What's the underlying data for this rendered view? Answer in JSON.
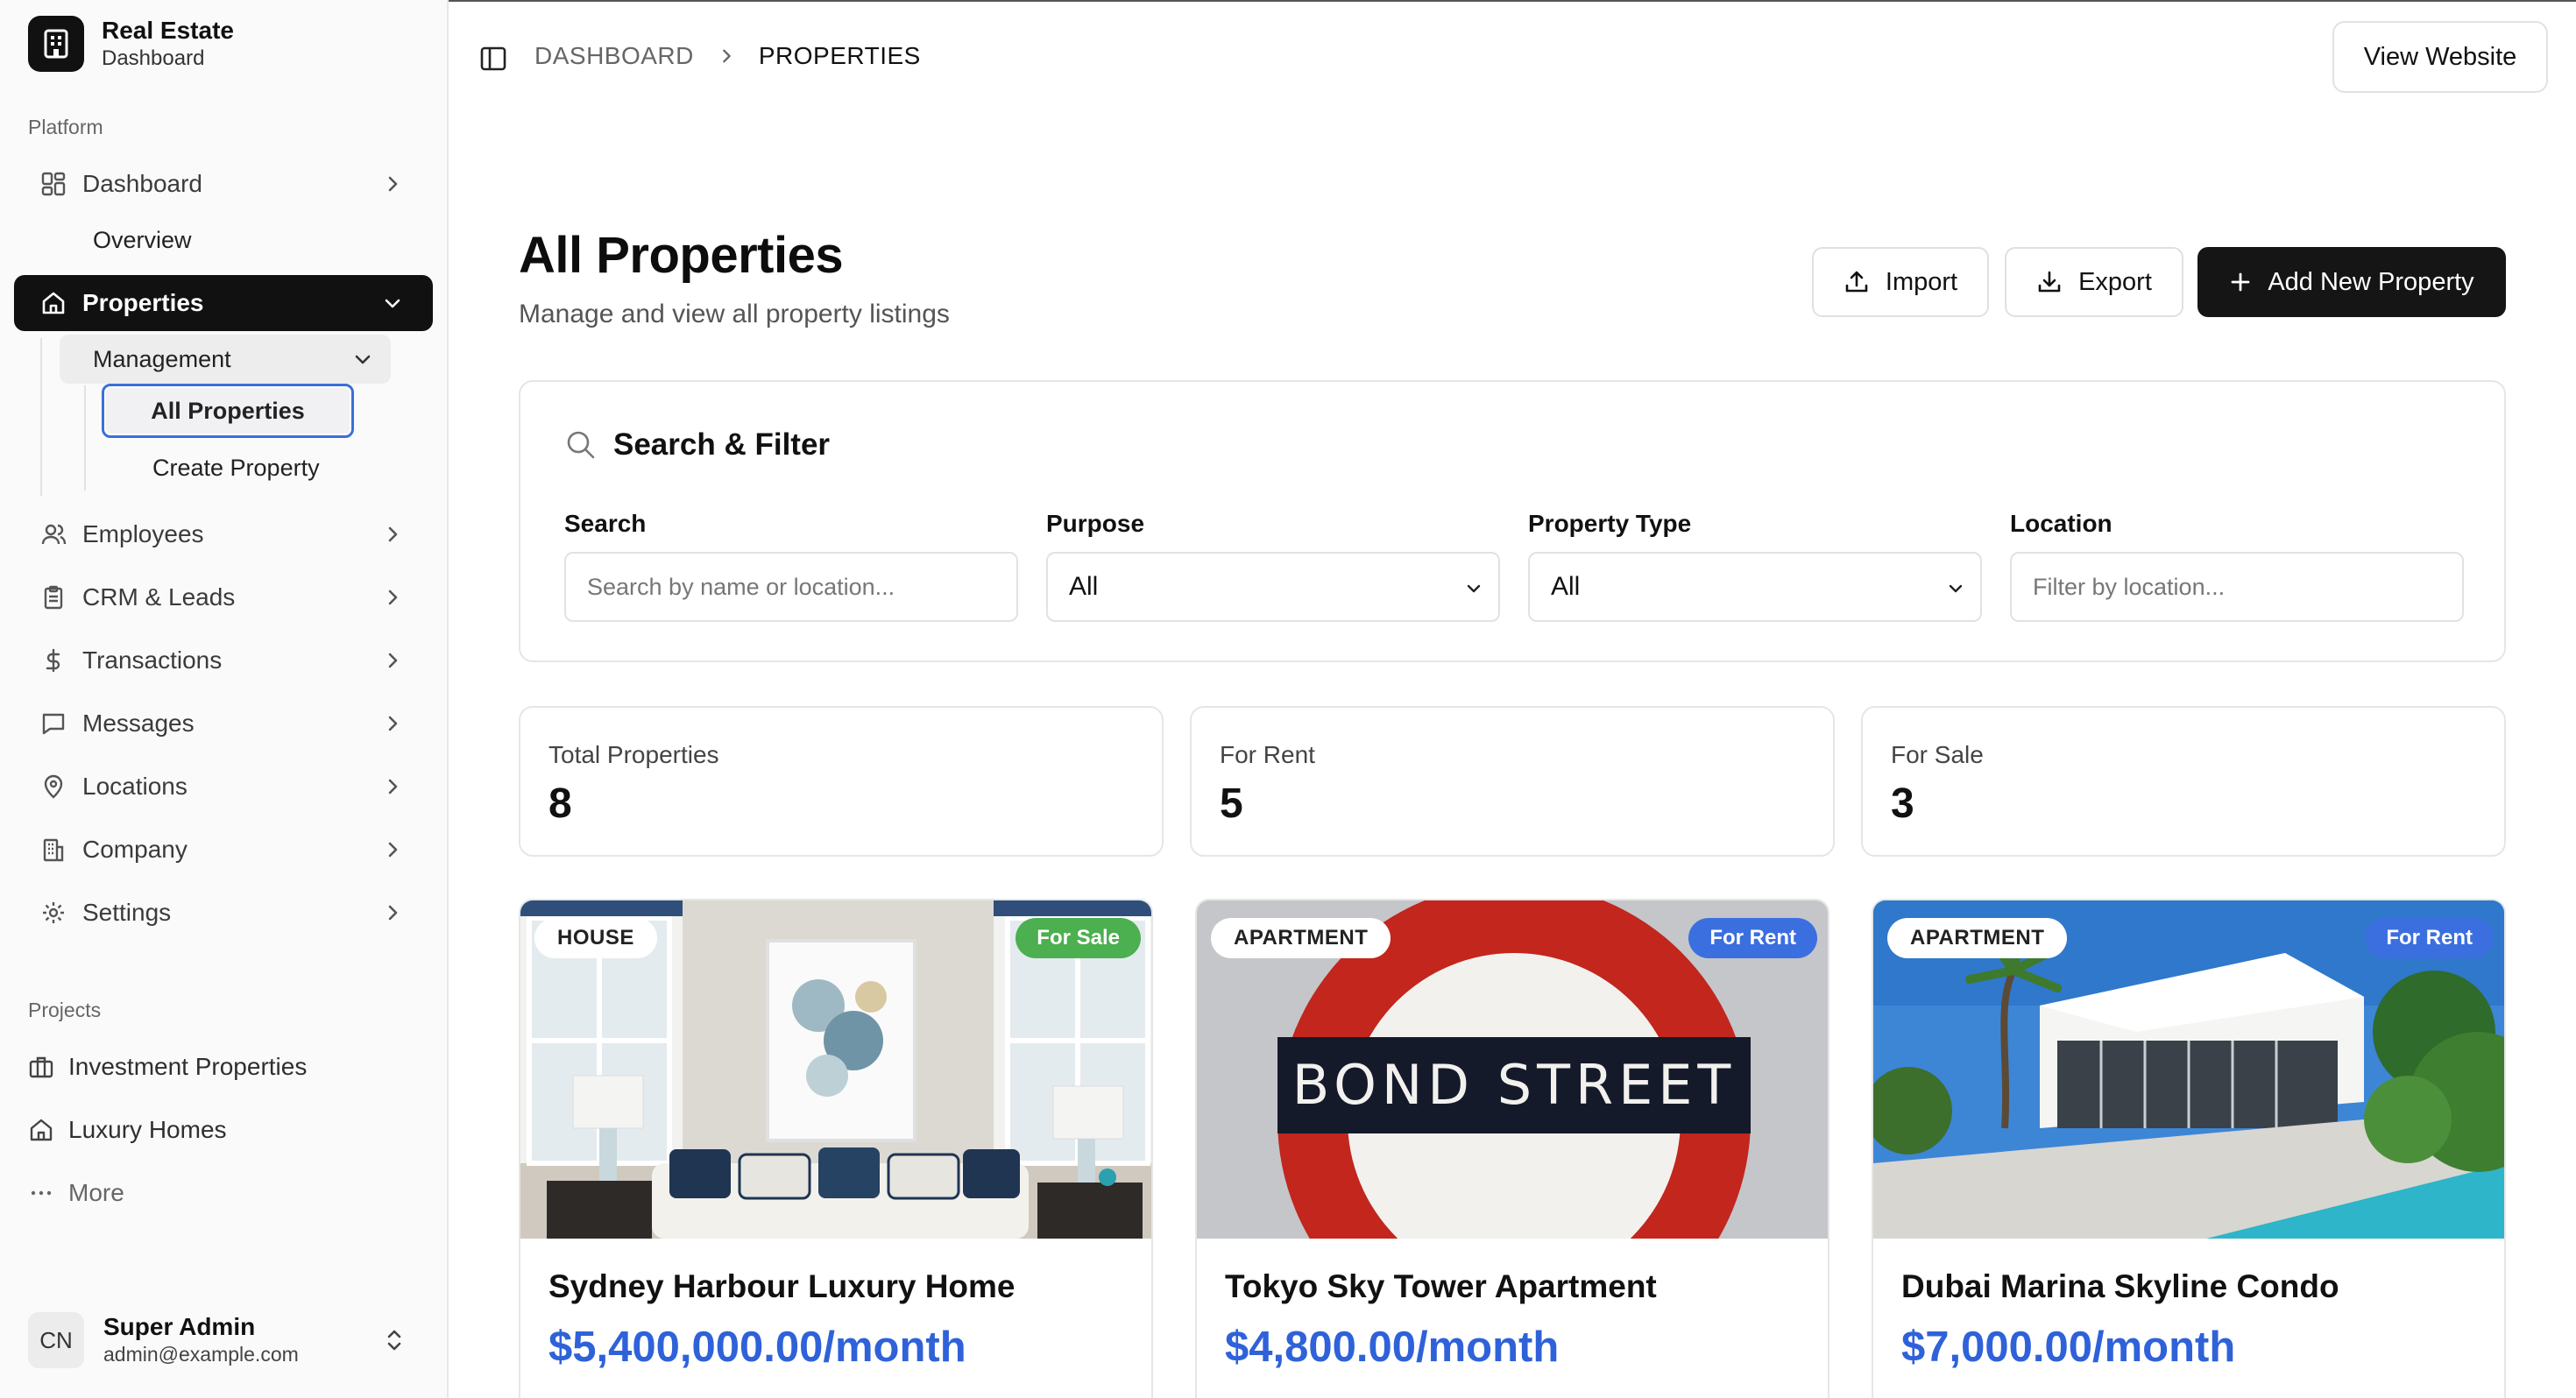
{
  "brand": {
    "title": "Real Estate",
    "subtitle": "Dashboard"
  },
  "sidebar": {
    "platform_label": "Platform",
    "dashboard": {
      "label": "Dashboard",
      "sub": "Overview"
    },
    "properties": {
      "label": "Properties",
      "management": "Management",
      "all_properties": "All Properties",
      "create_property": "Create Property"
    },
    "items": [
      {
        "label": "Employees",
        "icon": "users-icon"
      },
      {
        "label": "CRM & Leads",
        "icon": "clipboard-icon"
      },
      {
        "label": "Transactions",
        "icon": "dollar-icon"
      },
      {
        "label": "Messages",
        "icon": "message-icon"
      },
      {
        "label": "Locations",
        "icon": "map-pin-icon"
      },
      {
        "label": "Company",
        "icon": "building-icon"
      },
      {
        "label": "Settings",
        "icon": "gear-icon"
      }
    ],
    "projects_label": "Projects",
    "projects": [
      {
        "label": "Investment Properties",
        "icon": "briefcase-icon"
      },
      {
        "label": "Luxury Homes",
        "icon": "home-icon"
      },
      {
        "label": "More",
        "icon": "more-icon"
      }
    ]
  },
  "user": {
    "initials": "CN",
    "name": "Super Admin",
    "email": "admin@example.com"
  },
  "breadcrumb": {
    "parent": "DASHBOARD",
    "current": "PROPERTIES"
  },
  "topbar": {
    "view_website": "View Website"
  },
  "header": {
    "title": "All Properties",
    "subtitle": "Manage and view all property listings",
    "import": "Import",
    "export": "Export",
    "add_new": "Add New Property"
  },
  "filter": {
    "title": "Search & Filter",
    "search_label": "Search",
    "search_placeholder": "Search by name or location...",
    "purpose_label": "Purpose",
    "purpose_value": "All",
    "type_label": "Property Type",
    "type_value": "All",
    "location_label": "Location",
    "location_placeholder": "Filter by location..."
  },
  "stats": [
    {
      "label": "Total Properties",
      "value": "8"
    },
    {
      "label": "For Rent",
      "value": "5"
    },
    {
      "label": "For Sale",
      "value": "3"
    }
  ],
  "properties": [
    {
      "type": "HOUSE",
      "purpose": "For Sale",
      "title": "Sydney Harbour Luxury Home",
      "price": "$5,400,000.00/month"
    },
    {
      "type": "APARTMENT",
      "purpose": "For Rent",
      "title": "Tokyo Sky Tower Apartment",
      "price": "$4,800.00/month",
      "sign_text": "BOND STREET"
    },
    {
      "type": "APARTMENT",
      "purpose": "For Rent",
      "title": "Dubai Marina Skyline Condo",
      "price": "$7,000.00/month"
    }
  ],
  "colors": {
    "accent": "#2f62d9",
    "for_sale": "#4caf50",
    "for_rent": "#3b6fe0",
    "dark": "#151515"
  }
}
